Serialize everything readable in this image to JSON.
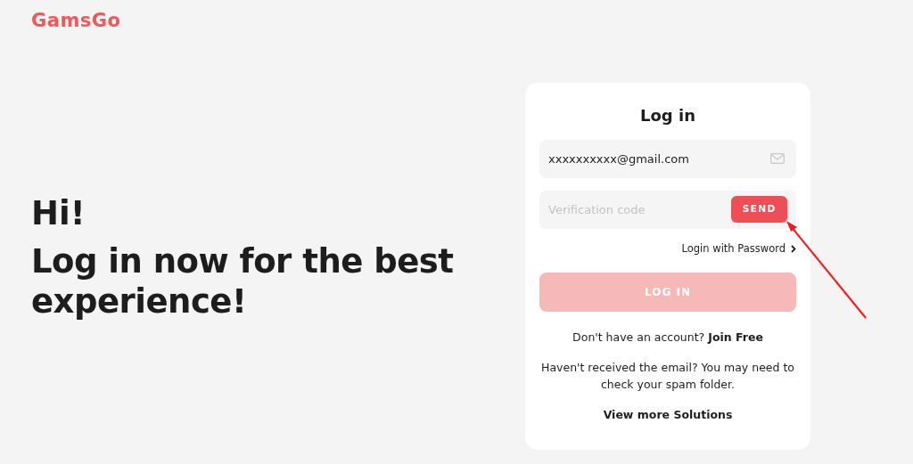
{
  "logo": "GamsGo",
  "hero": {
    "greeting": "Hi!",
    "headline": "Log in now for the best experience!"
  },
  "login": {
    "title": "Log in",
    "email": {
      "value": "xxxxxxxxxx@gmail.com"
    },
    "code": {
      "placeholder": "Verification code",
      "button": "SEND"
    },
    "password_link": "Login with Password",
    "submit": {
      "label": "LOG IN",
      "disabled": true
    },
    "signup_prompt": "Don't have an account?",
    "signup_link": "Join Free",
    "notice": "Haven't received the email? You may need to check your spam folder.",
    "solutions_link": "View more Solutions"
  }
}
